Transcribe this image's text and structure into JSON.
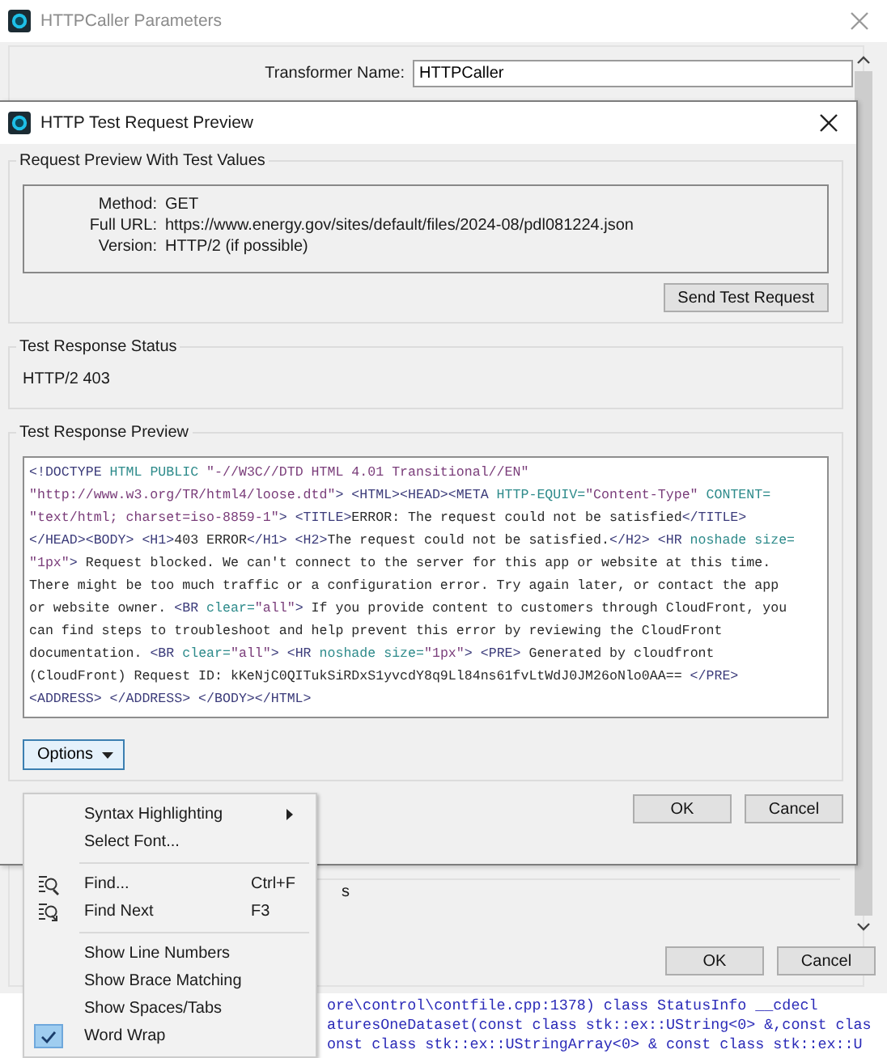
{
  "parent_window": {
    "title": "HTTPCaller Parameters",
    "name_label": "Transformer Name:",
    "name_value": "HTTPCaller",
    "fragment": "s",
    "buttons": [
      "OK",
      "Cancel"
    ]
  },
  "log_lines": [
    "ore\\control\\contfile.cpp:1378) class StatusInfo __cdecl",
    "aturesOneDataset(const class stk::ex::UString<0> &,const clas",
    "onst class stk::ex::UStringArray<0> & const class stk::ex::U"
  ],
  "dialog": {
    "title": "HTTP Test Request Preview",
    "request_group": {
      "title": "Request Preview With Test Values",
      "fields": [
        {
          "label": "Method:",
          "value": "GET"
        },
        {
          "label": "Full URL:",
          "value": "https://www.energy.gov/sites/default/files/2024-08/pdl081224.json"
        },
        {
          "label": "Version:",
          "value": "HTTP/2 (if possible)"
        }
      ],
      "button": "Send Test Request"
    },
    "status_group": {
      "title": "Test Response Status",
      "value": "HTTP/2 403"
    },
    "preview_group": {
      "title": "Test Response Preview",
      "lines": [
        [
          {
            "kind": "tag",
            "text": "<!DOCTYPE "
          },
          {
            "kind": "attr",
            "text": "HTML PUBLIC "
          },
          {
            "kind": "string",
            "text": "\"-//W3C//DTD HTML 4.01 Transitional//EN\""
          }
        ],
        [
          {
            "kind": "string",
            "text": "\"http://www.w3.org/TR/html4/loose.dtd\""
          },
          {
            "kind": "tag",
            "text": "> <HTML><HEAD><META "
          },
          {
            "kind": "attr",
            "text": "HTTP-EQUIV="
          },
          {
            "kind": "string",
            "text": "\"Content-Type\" "
          },
          {
            "kind": "attr",
            "text": "CONTENT="
          }
        ],
        [
          {
            "kind": "string",
            "text": "\"text/html; charset=iso-8859-1\""
          },
          {
            "kind": "tag",
            "text": "> <TITLE>"
          },
          {
            "kind": "text",
            "text": "ERROR: The request could not be satisfied"
          },
          {
            "kind": "tag",
            "text": "</TITLE>"
          }
        ],
        [
          {
            "kind": "tag",
            "text": "</HEAD><BODY> <H1>"
          },
          {
            "kind": "text",
            "text": "403 ERROR"
          },
          {
            "kind": "tag",
            "text": "</H1> <H2>"
          },
          {
            "kind": "text",
            "text": "The request could not be satisfied."
          },
          {
            "kind": "tag",
            "text": "</H2> <HR "
          },
          {
            "kind": "attr",
            "text": "noshade size="
          }
        ],
        [
          {
            "kind": "string",
            "text": "\"1px\""
          },
          {
            "kind": "tag",
            "text": ">"
          },
          {
            "kind": "text",
            "text": " Request blocked. We can't connect to the server for this app or website at this time."
          }
        ],
        [
          {
            "kind": "text",
            "text": "There might be too much traffic or a configuration error. Try again later, or contact the app"
          }
        ],
        [
          {
            "kind": "text",
            "text": "or website owner. "
          },
          {
            "kind": "tag",
            "text": "<BR "
          },
          {
            "kind": "attr",
            "text": "clear="
          },
          {
            "kind": "string",
            "text": "\"all\""
          },
          {
            "kind": "tag",
            "text": ">"
          },
          {
            "kind": "text",
            "text": " If you provide content to customers through CloudFront, you"
          }
        ],
        [
          {
            "kind": "text",
            "text": "can find steps to troubleshoot and help prevent this error by reviewing the CloudFront"
          }
        ],
        [
          {
            "kind": "text",
            "text": "documentation. "
          },
          {
            "kind": "tag",
            "text": "<BR "
          },
          {
            "kind": "attr",
            "text": "clear="
          },
          {
            "kind": "string",
            "text": "\"all\""
          },
          {
            "kind": "tag",
            "text": "> <HR "
          },
          {
            "kind": "attr",
            "text": "noshade size="
          },
          {
            "kind": "string",
            "text": "\"1px\""
          },
          {
            "kind": "tag",
            "text": "> <PRE>"
          },
          {
            "kind": "text",
            "text": " Generated by cloudfront"
          }
        ],
        [
          {
            "kind": "text",
            "text": "(CloudFront) Request ID: kKeNjC0QITukSiRDxS1yvcdY8q9Ll84ns61fvLtWdJ0JM26oNlo0AA== "
          },
          {
            "kind": "tag",
            "text": "</PRE>"
          }
        ],
        [
          {
            "kind": "tag",
            "text": "<ADDRESS> </ADDRESS> </BODY></HTML>"
          }
        ]
      ],
      "options_button": {
        "label": "Options",
        "open": true
      }
    },
    "buttons": [
      "OK",
      "Cancel"
    ]
  },
  "options_menu": [
    {
      "kind": "submenu",
      "label": "Syntax Highlighting"
    },
    {
      "kind": "item",
      "label": "Select Font..."
    },
    {
      "kind": "separator"
    },
    {
      "kind": "find",
      "label": "Find...",
      "shortcut": "Ctrl+F"
    },
    {
      "kind": "find_next",
      "label": "Find Next",
      "shortcut": "F3"
    },
    {
      "kind": "separator"
    },
    {
      "kind": "check",
      "label": "Show Line Numbers",
      "checked": false
    },
    {
      "kind": "check",
      "label": "Show Brace Matching",
      "checked": false
    },
    {
      "kind": "check",
      "label": "Show Spaces/Tabs",
      "checked": false
    },
    {
      "kind": "check",
      "label": "Word Wrap",
      "checked": true
    }
  ]
}
